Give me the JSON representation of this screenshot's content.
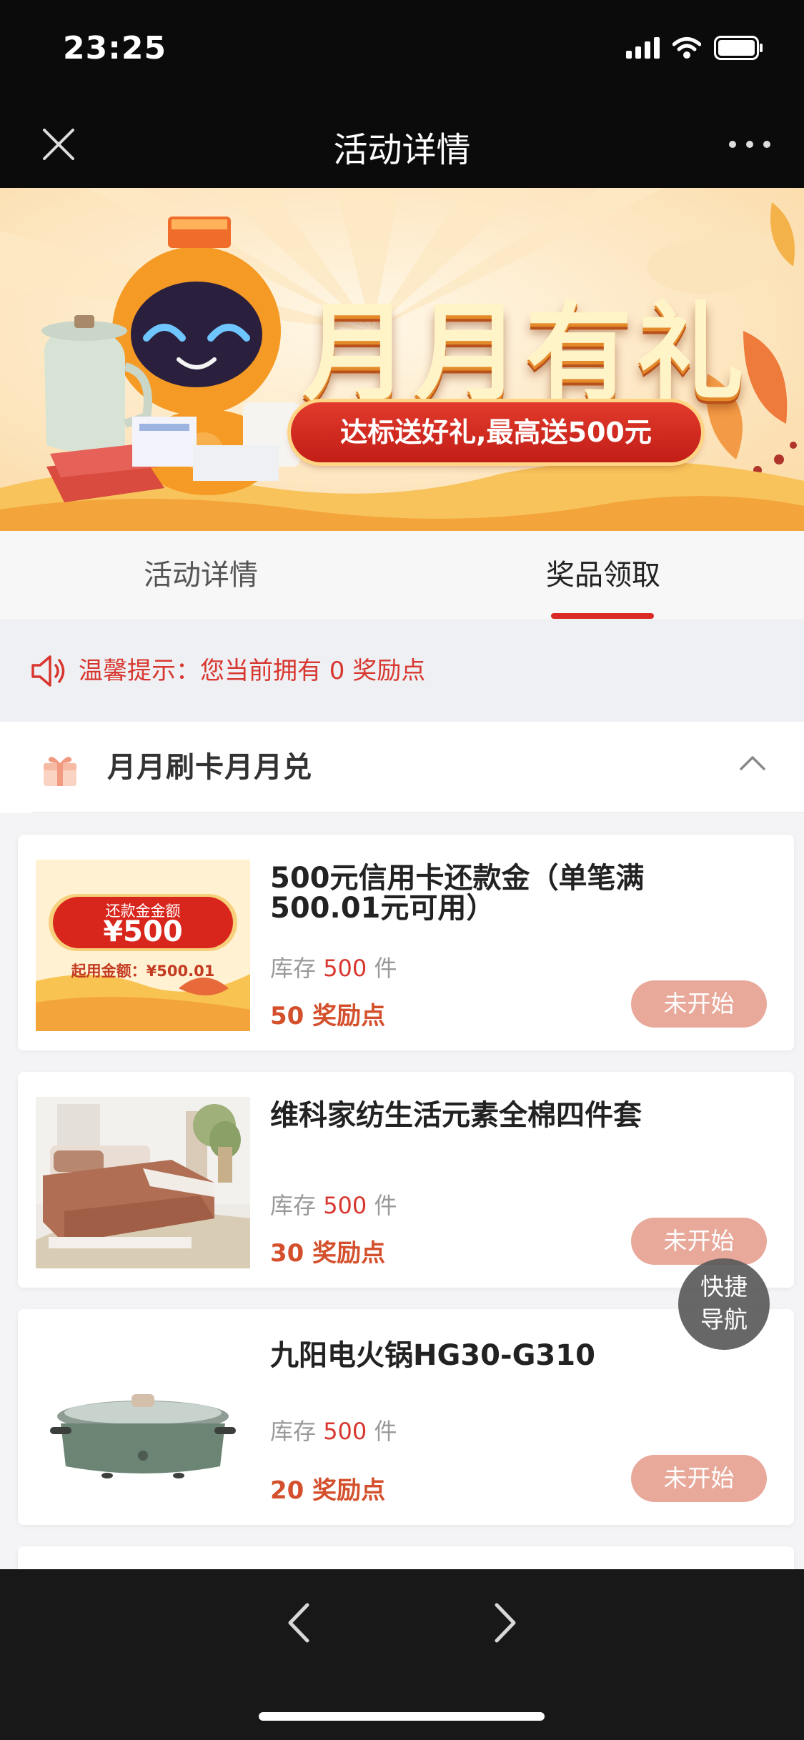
{
  "status_bar": {
    "time": "23:25"
  },
  "nav": {
    "title": "活动详情"
  },
  "banner": {
    "title": "月月有礼",
    "subtitle": "达标送好礼,最高送500元"
  },
  "tabs": [
    {
      "label": "活动详情"
    },
    {
      "label": "奖品领取",
      "active": true
    }
  ],
  "notice": {
    "text": "温馨提示：您当前拥有 0 奖励点"
  },
  "section": {
    "title": "月月刷卡月月兑"
  },
  "products": [
    {
      "title": "500元信用卡还款金（单笔满500.01元可用）",
      "stock_label": "库存",
      "stock": "500",
      "stock_unit": "件",
      "points": "50 奖励点",
      "button": "未开始",
      "image": {
        "label_top": "还款金金额",
        "amount": "¥500",
        "min_amount": "起用金额：¥500.01"
      }
    },
    {
      "title": "维科家纺生活元素全棉四件套",
      "stock_label": "库存",
      "stock": "500",
      "stock_unit": "件",
      "points": "30 奖励点",
      "button": "未开始"
    },
    {
      "title": "九阳电火锅HG30-G310",
      "stock_label": "库存",
      "stock": "500",
      "stock_unit": "件",
      "points": "20 奖励点",
      "button": "未开始"
    }
  ],
  "quick_nav": {
    "line1": "快捷",
    "line2": "导航"
  },
  "colors": {
    "accent_red": "#d92a25",
    "points_orange": "#d4502c",
    "button_pink": "#e8a99b",
    "dark_bar": "#0b0b0b"
  }
}
